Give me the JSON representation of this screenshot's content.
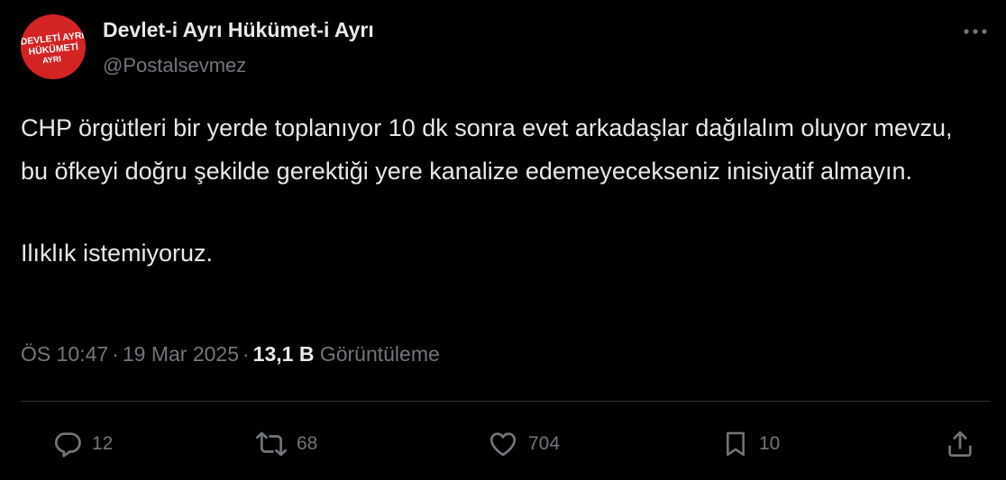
{
  "author": {
    "display_name": "Devlet-i Ayrı Hükümet-i Ayrı",
    "handle": "@Postalsevmez",
    "avatar_text_lines": [
      "DEVLETİ AYRI",
      "HÜKÜMETİ",
      "AYRI"
    ],
    "avatar_color": "#d42323"
  },
  "tweet": {
    "paragraph_1": "CHP örgütleri bir yerde toplanıyor 10 dk sonra evet arkadaşlar dağılalım oluyor mevzu, bu öfkeyi doğru şekilde gerektiği yere kanalize edemeyecekseniz inisiyatif almayın.",
    "paragraph_2": "Ilıklık istemiyoruz."
  },
  "meta": {
    "time": "ÖS 10:47",
    "date": "19 Mar 2025",
    "separator": "·",
    "views_count": "13,1 B",
    "views_label": "Görüntüleme"
  },
  "actions": {
    "reply_count": "12",
    "repost_count": "68",
    "like_count": "704",
    "bookmark_count": "10"
  },
  "icons": {
    "more": "more-dots-icon",
    "reply": "reply-icon",
    "repost": "repost-icon",
    "like": "heart-icon",
    "bookmark": "bookmark-icon",
    "share": "share-icon"
  },
  "colors": {
    "background": "#000000",
    "primary_text": "#e7e9ea",
    "secondary_text": "#71767b",
    "divider": "#2f3336"
  }
}
